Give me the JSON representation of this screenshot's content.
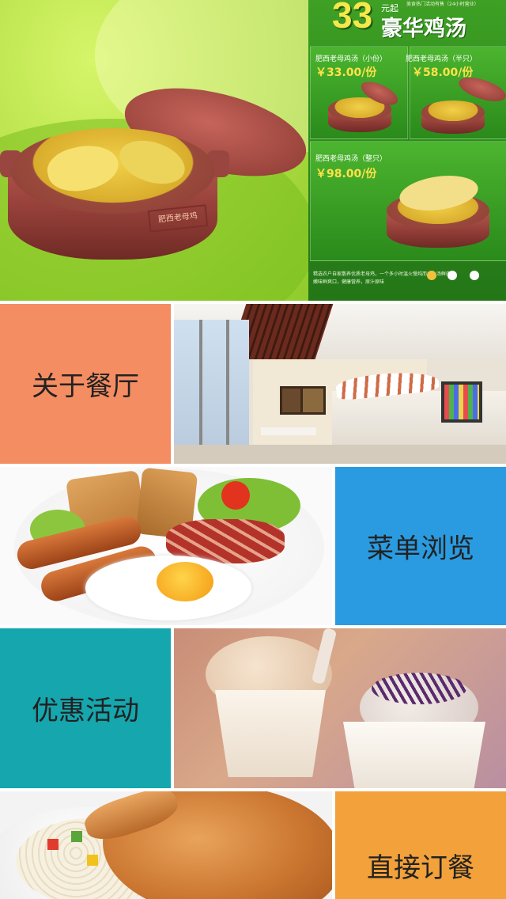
{
  "banner": {
    "headline_number": "33",
    "headline_suffix": "元起",
    "headline_title": "豪华鸡汤",
    "small_note": "美食热门活动有售（24小时营业）",
    "pot_stamp": "肥西老母鸡",
    "products": [
      {
        "name": "肥西老母鸡汤（小份）",
        "price": "￥33.00/份"
      },
      {
        "name": "肥西老母鸡汤（半只）",
        "price": "￥58.00/份"
      },
      {
        "name": "肥西老母鸡汤（整只）",
        "price": "￥98.00/份"
      }
    ],
    "description": "精选农户自家散养优质老母鸡，一个多小时温火慢炖而成，汤鲜肉嫩味鲜爽口，健康营养，原汁原味",
    "carousel_dots": 3,
    "colors": {
      "left_bg": "#b8e24a",
      "right_bg": "#2e8d1c",
      "price": "#ffe24a"
    }
  },
  "tiles": {
    "about": {
      "label": "关于餐厅",
      "color": "#f58d62"
    },
    "menu": {
      "label": "菜单浏览",
      "color": "#2a9be0"
    },
    "promotions": {
      "label": "优惠活动",
      "color": "#15a6ae"
    },
    "order": {
      "label": "直接订餐",
      "color": "#f2a13b"
    }
  },
  "images": {
    "restaurant": "restaurant-interior-photo",
    "breakfast": "breakfast-plate-photo",
    "icecream": "ice-cream-photo",
    "chicken": "roast-chicken-rice-photo"
  }
}
